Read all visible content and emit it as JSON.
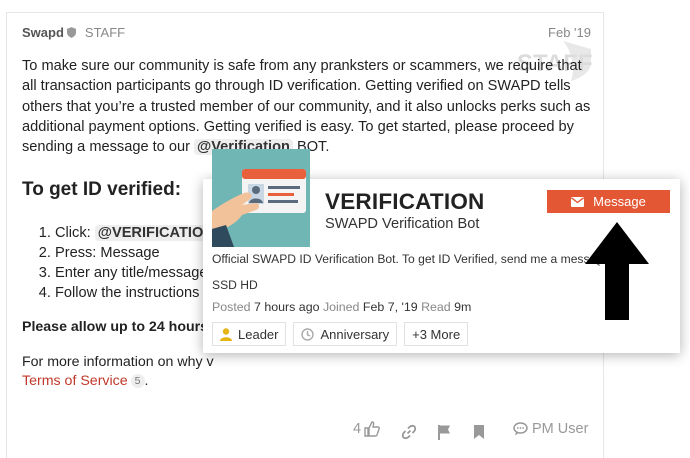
{
  "post": {
    "username": "Swapd",
    "role": "STAFF",
    "date": "Feb '19",
    "watermark": "STAFF",
    "intro_1": "To make sure our community is safe from any pranksters or scammers, we require that all transaction participants go through ID verification. Getting verified on SWAPD tells others that you’re a trusted member of our community, and it also unlocks perks such as additional payment options. Getting verified is easy. To get started, please proceed by sending a message to our ",
    "intro_mention": "@Verification",
    "intro_2": " BOT.",
    "heading": "To get ID verified:",
    "steps": {
      "s1_prefix": "Click: ",
      "s1_mention": "@VERIFICATION",
      "s2": "Press: Message",
      "s3": "Enter any title/message",
      "s4": "Follow the instructions se"
    },
    "note": "Please allow up to 24 hours",
    "more_prefix": "For more information on why v",
    "tos_link": "Terms of Service",
    "tos_count": "5",
    "tos_suffix": ".",
    "actions": {
      "like_count": "4",
      "pm_label": "PM User"
    }
  },
  "card": {
    "name": "VERIFICATION",
    "subtitle": "SWAPD Verification Bot",
    "message_button": "Message",
    "bio": "Official SWAPD ID Verification Bot. To get ID Verified, send me a message",
    "bio_line2": "SSD HD",
    "posted_label": "Posted",
    "posted_value": "7 hours ago",
    "joined_label": "Joined",
    "joined_value": "Feb 7, '19",
    "read_label": "Read",
    "read_value": "9m",
    "badges": [
      "Leader",
      "Anniversary",
      "+3 More"
    ]
  },
  "colors": {
    "accent": "#e45735",
    "link": "#c0392b",
    "avatar_bg": "#6fb6b4",
    "leader_icon": "#e7b416"
  }
}
